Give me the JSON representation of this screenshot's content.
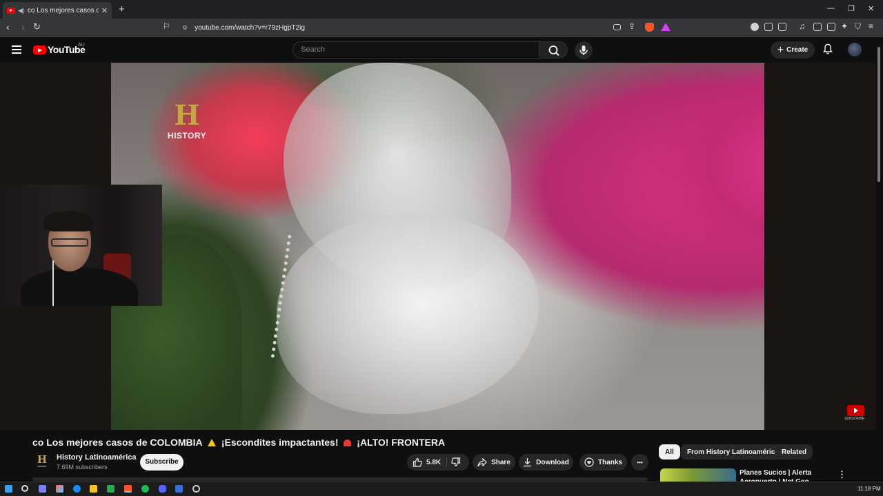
{
  "browser": {
    "tab_title": "co Los mejores casos de COLOMBIA",
    "new_tab_symbol": "+",
    "url": "youtube.com/watch?v=r79zHgpT2ig",
    "window_controls": [
      "—",
      "❐",
      "✕"
    ]
  },
  "youtube": {
    "logo_text": "YouTube",
    "region": "AU",
    "search_placeholder": "Search",
    "create_label": "Create"
  },
  "video": {
    "overlay_logo_letter": "H",
    "overlay_logo_text": "HISTORY",
    "watermark_text": "SUBSCRIBE",
    "title_part1": "co Los mejores casos de COLOMBIA",
    "title_part2": "¡Escondites impactantes!",
    "title_part3": "¡ALTO! FRONTERA"
  },
  "channel": {
    "name": "History Latinoamérica",
    "subscribers": "7.69M subscribers",
    "avatar_letter": "H",
    "avatar_text": "HISTORY",
    "subscribe_label": "Subscribe"
  },
  "actions": {
    "likes": "5.8K",
    "share": "Share",
    "download": "Download",
    "thanks": "Thanks",
    "more": "•••"
  },
  "sidebar": {
    "chips": [
      "All",
      "From History Latinoamérica",
      "Related"
    ],
    "recommendation_title": "Planes Sucios | Alerta Aeropuerto | Nat Geo en"
  },
  "taskbar": {
    "time": "11:18 PM"
  },
  "colors": {
    "youtube_red": "#ff0000",
    "history_gold": "#c9a24a",
    "background": "#0f0f0f"
  }
}
